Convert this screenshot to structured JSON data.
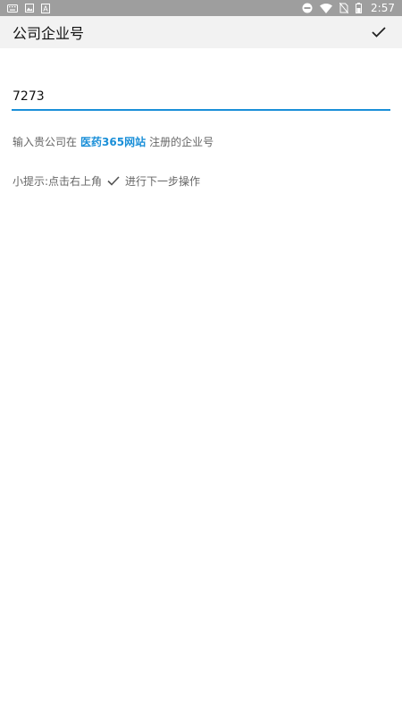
{
  "status_bar": {
    "time": "2:57",
    "left_icons": [
      "keyboard-icon",
      "image-icon",
      "font-app-icon"
    ],
    "right_icons": [
      "dnd-icon",
      "wifi-icon",
      "no-sim-icon",
      "battery-icon"
    ]
  },
  "app_bar": {
    "title": "公司企业号",
    "confirm_icon": "check-icon"
  },
  "form": {
    "company_id_value": "7273",
    "company_id_placeholder": ""
  },
  "hint": {
    "prefix": "输入贵公司在",
    "brand": "医药365网站",
    "suffix": "注册的企业号"
  },
  "tip": {
    "prefix": "小提示:点击右上角",
    "suffix": "进行下一步操作"
  },
  "colors": {
    "accent": "#1a8fd8",
    "status_bar": "#9e9e9e",
    "app_bar": "#f2f2f2",
    "secondary_text": "#666666"
  }
}
